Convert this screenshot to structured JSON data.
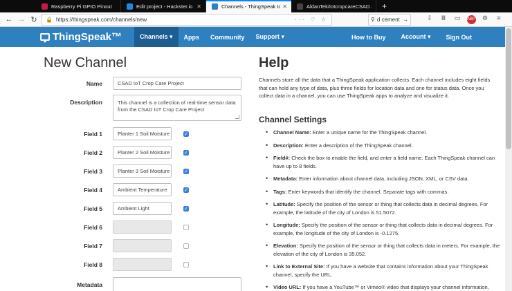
{
  "browser": {
    "tabs": [
      {
        "label": "Raspberry Pi GPIO Pinout",
        "favicon_color": "#c51a4a"
      },
      {
        "label": "Edit project - Hackster.io",
        "favicon_color": "#1e88e5"
      },
      {
        "label": "Channels - ThingSpeak IoT",
        "favicon_color": "#2e80bf",
        "active": true
      },
      {
        "label": "AldanTek/IotcropcareCSAD at m",
        "favicon_color": "#222222"
      }
    ],
    "new_tab": "+",
    "url": "https://thingspeak.com/channels/new",
    "search_value": "d cement"
  },
  "header": {
    "logo": "ThingSpeak™",
    "menu": [
      "Channels ▾",
      "Apps",
      "Community",
      "Support ▾"
    ],
    "menu_right": [
      "How to Buy",
      "Account ▾",
      "Sign Out"
    ],
    "brand_color": "#2e80bf"
  },
  "form": {
    "title": "New Channel",
    "name_label": "Name",
    "name_value": "CSAD IoT Crop Care Project",
    "description_label": "Description",
    "description_value": "This channel is a collection of real-time sensor data from the CSAD IoT Crop Care Project",
    "fields": [
      {
        "label": "Field 1",
        "value": "Planter 1 Soil Moisture",
        "checked": true
      },
      {
        "label": "Field 2",
        "value": "Planter 2 Soil Moisture",
        "checked": true
      },
      {
        "label": "Field 3",
        "value": "Planter 3 Soil Moisture",
        "checked": true
      },
      {
        "label": "Field 4",
        "value": "Ambient Temperature",
        "checked": true
      },
      {
        "label": "Field 5",
        "value": "Ambient Light",
        "checked": true
      },
      {
        "label": "Field 6",
        "value": "",
        "checked": false
      },
      {
        "label": "Field 7",
        "value": "",
        "checked": false
      },
      {
        "label": "Field 8",
        "value": "",
        "checked": false
      }
    ],
    "metadata_label": "Metadata"
  },
  "help": {
    "title": "Help",
    "intro": "Channels store all the data that a ThingSpeak application collects. Each channel includes eight fields that can hold any type of data, plus three fields for location data and one for status data. Once you collect data in a channel, you can use ThingSpeak apps to analyze and visualize it.",
    "settings_title": "Channel Settings",
    "items": [
      {
        "term": "Channel Name:",
        "text": " Enter a unique name for the ThingSpeak channel."
      },
      {
        "term": "Description:",
        "text": " Enter a description of the ThingSpeak channel."
      },
      {
        "term": "Field#:",
        "text": " Check the box to enable the field, and enter a field name. Each ThingSpeak channel can have up to 8 fields."
      },
      {
        "term": "Metadata:",
        "text": " Enter information about channel data, including JSON, XML, or CSV data."
      },
      {
        "term": "Tags:",
        "text": " Enter keywords that identify the channel. Separate tags with commas."
      },
      {
        "term": "Latitude:",
        "text": " Specify the position of the sensor or thing that collects data in decimal degrees. For example, the latitude of the city of London is 51.5072."
      },
      {
        "term": "Longitude:",
        "text": " Specify the position of the sensor or thing that collects data in decimal degrees. For example, the longitude of the city of London is -0.1275."
      },
      {
        "term": "Elevation:",
        "text": " Specify the position of the sensor or thing that collects data in meters. For example, the elevation of the city of London is 35.052."
      },
      {
        "term": "Link to External Site:",
        "text": " If you have a website that contains information about your ThingSpeak channel, specify the URL."
      },
      {
        "term": "Video URL:",
        "text": " If you have a YouTube™ or Vimeo® video that displays your channel information, specify the full path of the video URL."
      }
    ]
  }
}
